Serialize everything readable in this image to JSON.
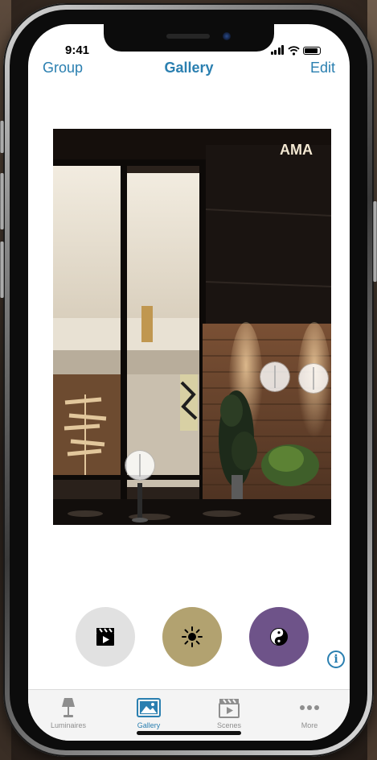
{
  "status_bar": {
    "time": "9:41"
  },
  "nav": {
    "left_label": "Group",
    "title": "Gallery",
    "right_label": "Edit"
  },
  "photo": {
    "sign_text": "AMA"
  },
  "mode_buttons": [
    {
      "name": "scene-mode",
      "icon": "clapperboard-icon",
      "color": "#e1e1e1"
    },
    {
      "name": "brightness-mode",
      "icon": "sun-icon",
      "color": "#b2a270"
    },
    {
      "name": "balance-mode",
      "icon": "yin-yang-icon",
      "color": "#6e5389"
    }
  ],
  "info": {
    "glyph": "i"
  },
  "tabs": [
    {
      "label": "Luminaires",
      "icon": "lamp-icon",
      "active": false
    },
    {
      "label": "Gallery",
      "icon": "gallery-icon",
      "active": true
    },
    {
      "label": "Scenes",
      "icon": "clapperboard-icon",
      "active": false
    },
    {
      "label": "More",
      "icon": "more-icon",
      "active": false
    }
  ],
  "colors": {
    "accent": "#2a7fb0",
    "tab_inactive": "#8e8e8e",
    "brightness_button": "#b2a270",
    "balance_button": "#6e5389",
    "scene_button": "#e1e1e1"
  }
}
